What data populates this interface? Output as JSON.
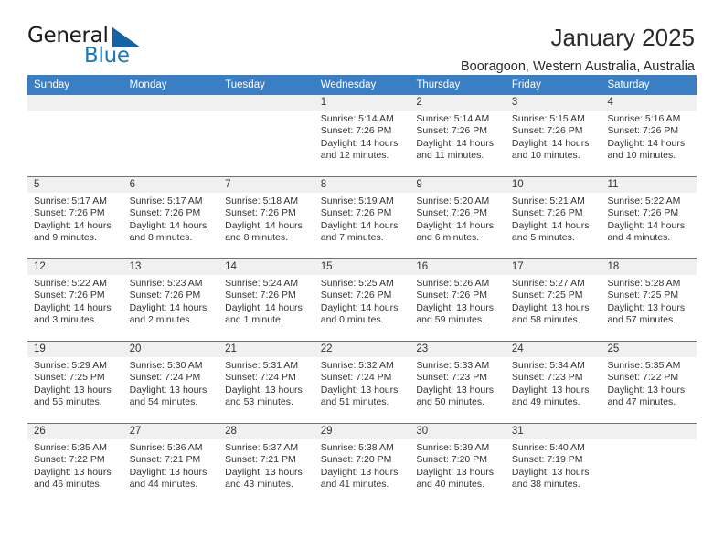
{
  "brand": {
    "name_part1": "General",
    "name_part2": "Blue",
    "triangle_color": "#1464a5",
    "blue_text_color": "#1878be"
  },
  "header": {
    "title": "January 2025",
    "location": "Booragoon, Western Australia, Australia"
  },
  "theme": {
    "header_blue": "#3a7ec4",
    "date_band_gray": "#f0f0f0"
  },
  "weekday_headers": [
    "Sunday",
    "Monday",
    "Tuesday",
    "Wednesday",
    "Thursday",
    "Friday",
    "Saturday"
  ],
  "labels": {
    "sunrise_prefix": "Sunrise:",
    "sunset_prefix": "Sunset:",
    "daylight_prefix": "Daylight:"
  },
  "weeks": [
    [
      {
        "day": "",
        "empty": true
      },
      {
        "day": "",
        "empty": true
      },
      {
        "day": "",
        "empty": true
      },
      {
        "day": "1",
        "sunrise": "Sunrise: 5:14 AM",
        "sunset": "Sunset: 7:26 PM",
        "daylight": "Daylight: 14 hours and 12 minutes."
      },
      {
        "day": "2",
        "sunrise": "Sunrise: 5:14 AM",
        "sunset": "Sunset: 7:26 PM",
        "daylight": "Daylight: 14 hours and 11 minutes."
      },
      {
        "day": "3",
        "sunrise": "Sunrise: 5:15 AM",
        "sunset": "Sunset: 7:26 PM",
        "daylight": "Daylight: 14 hours and 10 minutes."
      },
      {
        "day": "4",
        "sunrise": "Sunrise: 5:16 AM",
        "sunset": "Sunset: 7:26 PM",
        "daylight": "Daylight: 14 hours and 10 minutes."
      }
    ],
    [
      {
        "day": "5",
        "sunrise": "Sunrise: 5:17 AM",
        "sunset": "Sunset: 7:26 PM",
        "daylight": "Daylight: 14 hours and 9 minutes."
      },
      {
        "day": "6",
        "sunrise": "Sunrise: 5:17 AM",
        "sunset": "Sunset: 7:26 PM",
        "daylight": "Daylight: 14 hours and 8 minutes."
      },
      {
        "day": "7",
        "sunrise": "Sunrise: 5:18 AM",
        "sunset": "Sunset: 7:26 PM",
        "daylight": "Daylight: 14 hours and 8 minutes."
      },
      {
        "day": "8",
        "sunrise": "Sunrise: 5:19 AM",
        "sunset": "Sunset: 7:26 PM",
        "daylight": "Daylight: 14 hours and 7 minutes."
      },
      {
        "day": "9",
        "sunrise": "Sunrise: 5:20 AM",
        "sunset": "Sunset: 7:26 PM",
        "daylight": "Daylight: 14 hours and 6 minutes."
      },
      {
        "day": "10",
        "sunrise": "Sunrise: 5:21 AM",
        "sunset": "Sunset: 7:26 PM",
        "daylight": "Daylight: 14 hours and 5 minutes."
      },
      {
        "day": "11",
        "sunrise": "Sunrise: 5:22 AM",
        "sunset": "Sunset: 7:26 PM",
        "daylight": "Daylight: 14 hours and 4 minutes."
      }
    ],
    [
      {
        "day": "12",
        "sunrise": "Sunrise: 5:22 AM",
        "sunset": "Sunset: 7:26 PM",
        "daylight": "Daylight: 14 hours and 3 minutes."
      },
      {
        "day": "13",
        "sunrise": "Sunrise: 5:23 AM",
        "sunset": "Sunset: 7:26 PM",
        "daylight": "Daylight: 14 hours and 2 minutes."
      },
      {
        "day": "14",
        "sunrise": "Sunrise: 5:24 AM",
        "sunset": "Sunset: 7:26 PM",
        "daylight": "Daylight: 14 hours and 1 minute."
      },
      {
        "day": "15",
        "sunrise": "Sunrise: 5:25 AM",
        "sunset": "Sunset: 7:26 PM",
        "daylight": "Daylight: 14 hours and 0 minutes."
      },
      {
        "day": "16",
        "sunrise": "Sunrise: 5:26 AM",
        "sunset": "Sunset: 7:26 PM",
        "daylight": "Daylight: 13 hours and 59 minutes."
      },
      {
        "day": "17",
        "sunrise": "Sunrise: 5:27 AM",
        "sunset": "Sunset: 7:25 PM",
        "daylight": "Daylight: 13 hours and 58 minutes."
      },
      {
        "day": "18",
        "sunrise": "Sunrise: 5:28 AM",
        "sunset": "Sunset: 7:25 PM",
        "daylight": "Daylight: 13 hours and 57 minutes."
      }
    ],
    [
      {
        "day": "19",
        "sunrise": "Sunrise: 5:29 AM",
        "sunset": "Sunset: 7:25 PM",
        "daylight": "Daylight: 13 hours and 55 minutes."
      },
      {
        "day": "20",
        "sunrise": "Sunrise: 5:30 AM",
        "sunset": "Sunset: 7:24 PM",
        "daylight": "Daylight: 13 hours and 54 minutes."
      },
      {
        "day": "21",
        "sunrise": "Sunrise: 5:31 AM",
        "sunset": "Sunset: 7:24 PM",
        "daylight": "Daylight: 13 hours and 53 minutes."
      },
      {
        "day": "22",
        "sunrise": "Sunrise: 5:32 AM",
        "sunset": "Sunset: 7:24 PM",
        "daylight": "Daylight: 13 hours and 51 minutes."
      },
      {
        "day": "23",
        "sunrise": "Sunrise: 5:33 AM",
        "sunset": "Sunset: 7:23 PM",
        "daylight": "Daylight: 13 hours and 50 minutes."
      },
      {
        "day": "24",
        "sunrise": "Sunrise: 5:34 AM",
        "sunset": "Sunset: 7:23 PM",
        "daylight": "Daylight: 13 hours and 49 minutes."
      },
      {
        "day": "25",
        "sunrise": "Sunrise: 5:35 AM",
        "sunset": "Sunset: 7:22 PM",
        "daylight": "Daylight: 13 hours and 47 minutes."
      }
    ],
    [
      {
        "day": "26",
        "sunrise": "Sunrise: 5:35 AM",
        "sunset": "Sunset: 7:22 PM",
        "daylight": "Daylight: 13 hours and 46 minutes."
      },
      {
        "day": "27",
        "sunrise": "Sunrise: 5:36 AM",
        "sunset": "Sunset: 7:21 PM",
        "daylight": "Daylight: 13 hours and 44 minutes."
      },
      {
        "day": "28",
        "sunrise": "Sunrise: 5:37 AM",
        "sunset": "Sunset: 7:21 PM",
        "daylight": "Daylight: 13 hours and 43 minutes."
      },
      {
        "day": "29",
        "sunrise": "Sunrise: 5:38 AM",
        "sunset": "Sunset: 7:20 PM",
        "daylight": "Daylight: 13 hours and 41 minutes."
      },
      {
        "day": "30",
        "sunrise": "Sunrise: 5:39 AM",
        "sunset": "Sunset: 7:20 PM",
        "daylight": "Daylight: 13 hours and 40 minutes."
      },
      {
        "day": "31",
        "sunrise": "Sunrise: 5:40 AM",
        "sunset": "Sunset: 7:19 PM",
        "daylight": "Daylight: 13 hours and 38 minutes."
      },
      {
        "day": "",
        "empty": true
      }
    ]
  ]
}
